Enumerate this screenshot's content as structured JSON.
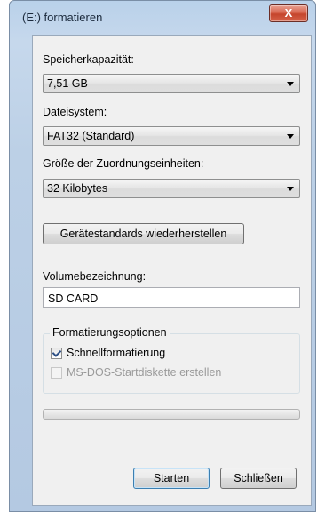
{
  "window": {
    "title": "(E:) formatieren",
    "close_label": "X"
  },
  "capacity": {
    "label": "Speicherkapazität:",
    "value": "7,51 GB"
  },
  "filesystem": {
    "label": "Dateisystem:",
    "value": "FAT32 (Standard)"
  },
  "allocation": {
    "label": "Größe der Zuordnungseinheiten:",
    "value": "32 Kilobytes"
  },
  "restore_defaults_label": "Gerätestandards wiederherstellen",
  "volume": {
    "label": "Volumebezeichnung:",
    "value": "SD CARD"
  },
  "format_options": {
    "title": "Formatierungsoptionen",
    "quick_format": {
      "label": "Schnellformatierung",
      "checked": true
    },
    "msdos_boot": {
      "label": "MS-DOS-Startdiskette erstellen",
      "checked": false,
      "enabled": false
    }
  },
  "progress": {
    "fraction": 0
  },
  "buttons": {
    "start": "Starten",
    "close": "Schließen"
  }
}
